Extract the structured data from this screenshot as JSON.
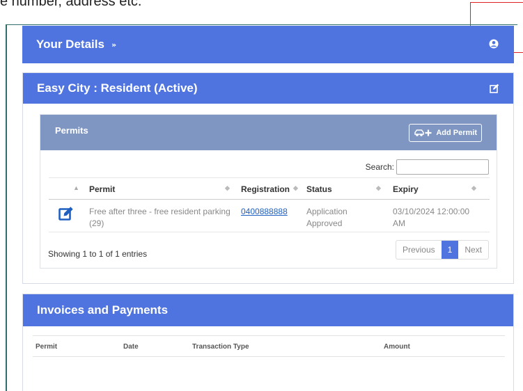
{
  "caption": "e number, address etc.",
  "details": {
    "title": "Your Details"
  },
  "city": {
    "title": "Easy City : Resident (Active)"
  },
  "permits": {
    "title": "Permits",
    "add_label": "Add Permit",
    "search_label": "Search:",
    "search_value": "",
    "columns": [
      "Permit",
      "Registration",
      "Status",
      "Expiry"
    ],
    "rows": [
      {
        "permit_line1": "Free after three - free resident parking",
        "permit_line2": "(29)",
        "registration": "0400888888",
        "status_line1": "Application",
        "status_line2": "Approved",
        "expiry_line1": "03/10/2024 12:00:00",
        "expiry_line2": "AM"
      }
    ],
    "info": "Showing 1 to 1 of 1 entries",
    "pager": {
      "previous": "Previous",
      "current": "1",
      "next": "Next"
    }
  },
  "invoices": {
    "title": "Invoices and Payments",
    "columns": [
      "Permit",
      "Date",
      "Transaction Type",
      "Amount"
    ]
  },
  "colors": {
    "header_blue": "#4f74e0",
    "permits_header": "#7f96c3",
    "link": "#1f5fbf",
    "highlight_border": "#e02020"
  },
  "icons": {
    "details_toggle": "chevron-double-down-icon",
    "profile": "user-circle-icon",
    "edit": "edit-icon",
    "add_permit": "car-plus-icon"
  }
}
